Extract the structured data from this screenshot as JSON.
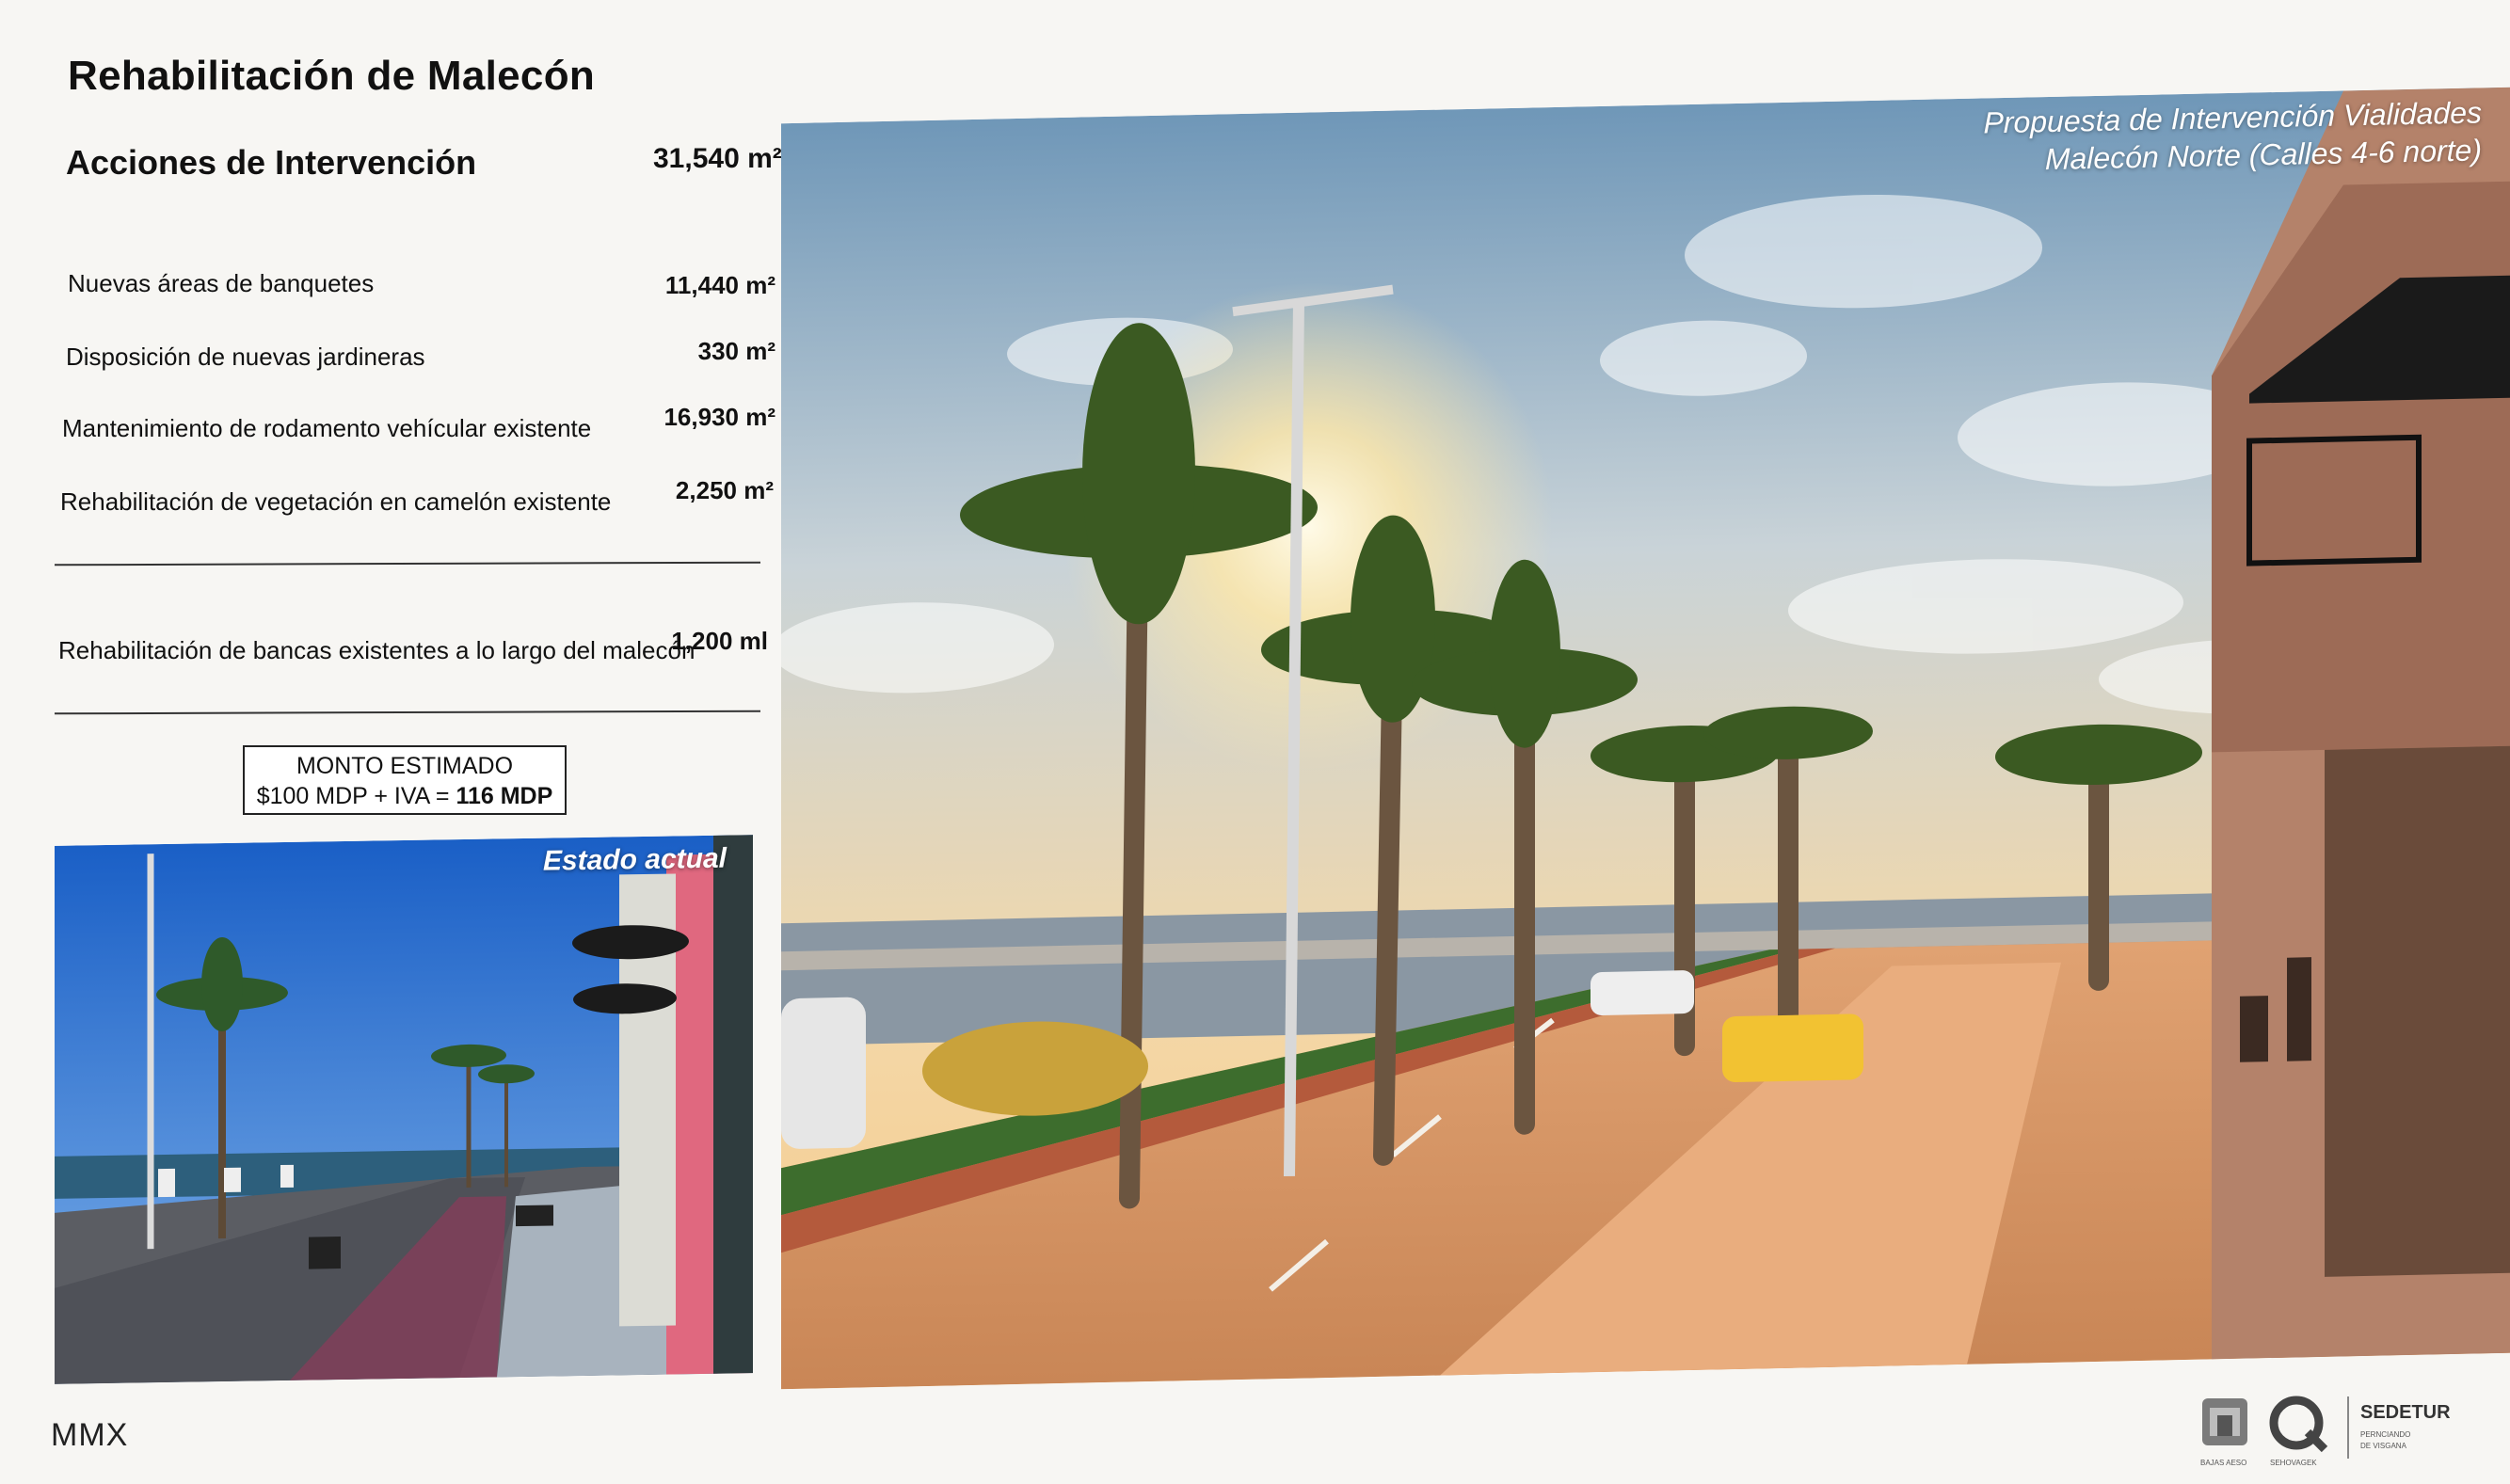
{
  "page": {
    "title": "Rehabilitación de Malecón",
    "section_title": "Acciones de Intervención",
    "total_area": "31,540 m²"
  },
  "actions": [
    {
      "label": "Nuevas áreas de banquetes",
      "value": "11,440 m²"
    },
    {
      "label": "Disposición de nuevas jardineras",
      "value": "330 m²"
    },
    {
      "label": "Mantenimiento de rodamento vehícular existente",
      "value": "16,930 m²"
    },
    {
      "label": "Rehabilitación de vegetación en camelón existente",
      "value": "2,250 m²"
    }
  ],
  "extra_action": {
    "label": "Rehabilitación de bancas existentes a lo largo del malecón",
    "value": "1,200 ml"
  },
  "estimate": {
    "line1": "MONTO ESTIMADO",
    "line2_prefix": "$100 MDP + IVA = ",
    "line2_total": "116 MDP"
  },
  "current_photo": {
    "caption": "Estado actual"
  },
  "proposal_photo": {
    "caption_line1": "Propuesta de Intervención Vialidades",
    "caption_line2": "Malecón Norte (Calles 4-6 norte)"
  },
  "footer": {
    "left_text": "MMX",
    "logos": {
      "logo1_label": "BAJAS AESO",
      "logo2_label": "SEHOVAGEK",
      "logo3_title": "SEDETUR",
      "logo3_sub1": "PERNCIANDO",
      "logo3_sub2": "DE VISGANA"
    }
  },
  "colors": {
    "sky": "#f3d8a8",
    "sun": "#fff2c6",
    "pavement": "#d99466",
    "sea": "#8a97a3"
  }
}
